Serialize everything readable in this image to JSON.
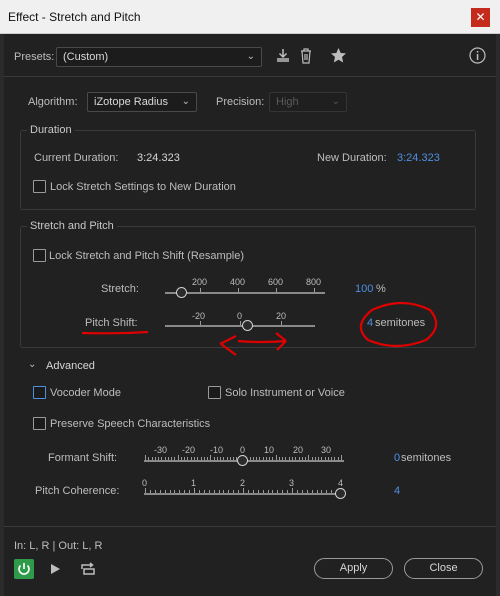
{
  "window": {
    "title": "Effect - Stretch and Pitch",
    "close_glyph": "✕"
  },
  "presets": {
    "label": "Presets:",
    "value": "(Custom)"
  },
  "algorithm": {
    "label": "Algorithm:",
    "value": "iZotope Radius"
  },
  "precision": {
    "label": "Precision:",
    "value": "High"
  },
  "duration": {
    "title": "Duration",
    "current_label": "Current Duration:",
    "current_value": "3:24.323",
    "new_label": "New Duration:",
    "new_value": "3:24.323",
    "lock_label": "Lock Stretch Settings to New Duration"
  },
  "stretch_pitch": {
    "title": "Stretch and Pitch",
    "lock_label": "Lock Stretch and Pitch Shift (Resample)",
    "stretch": {
      "label": "Stretch:",
      "ticks": [
        "200",
        "400",
        "600",
        "800"
      ],
      "value": "100",
      "unit": "%"
    },
    "pitch": {
      "label": "Pitch Shift:",
      "ticks": [
        "-20",
        "0",
        "20"
      ],
      "value": "4",
      "unit": "semitones"
    }
  },
  "advanced": {
    "title": "Advanced",
    "vocoder_label": "Vocoder Mode",
    "solo_label": "Solo Instrument or Voice",
    "preserve_label": "Preserve Speech Characteristics",
    "formant": {
      "label": "Formant Shift:",
      "ticks": [
        "-30",
        "-20",
        "-10",
        "0",
        "10",
        "20",
        "30"
      ],
      "value": "0",
      "unit": "semitones"
    },
    "coherence": {
      "label": "Pitch Coherence:",
      "ticks": [
        "0",
        "1",
        "2",
        "3",
        "4"
      ],
      "value": "4"
    }
  },
  "footer": {
    "io": "In: L, R | Out: L, R",
    "apply": "Apply",
    "close": "Close"
  },
  "colors": {
    "accent": "#4f8fe0",
    "power": "#2f9a4a",
    "annotation": "#e00000"
  }
}
